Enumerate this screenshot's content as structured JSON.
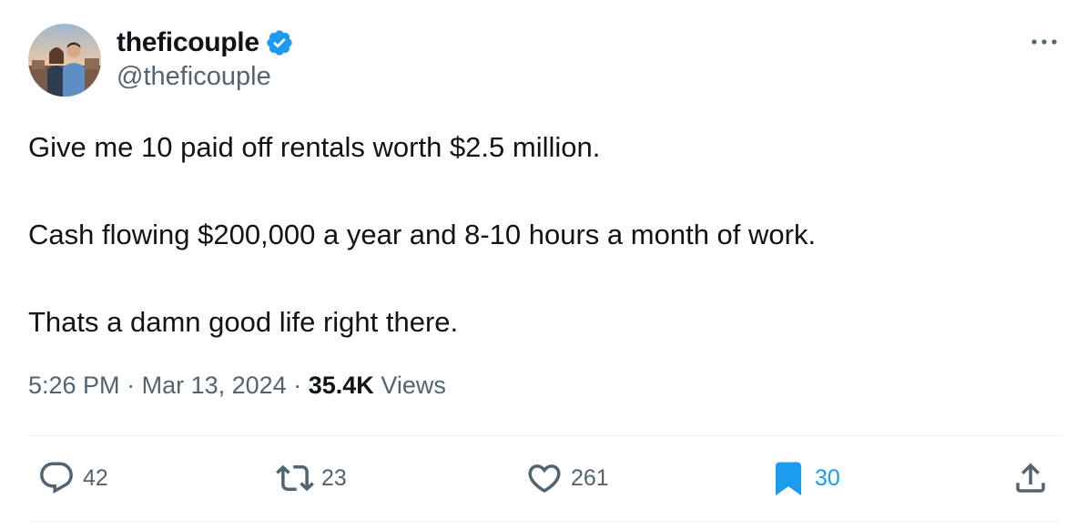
{
  "author": {
    "display_name": "theficouple",
    "handle": "@theficouple",
    "verified": true,
    "avatar_alt": "avatar-photo"
  },
  "tweet": {
    "paragraphs": [
      "Give me 10 paid off rentals worth $2.5 million.",
      "Cash flowing $200,000 a year and 8-10 hours a month of work.",
      "Thats a damn good life right there."
    ],
    "time": "5:26 PM",
    "separator": "·",
    "date": "Mar 13, 2024",
    "views_count": "35.4K",
    "views_label": "Views"
  },
  "actions": {
    "reply_count": "42",
    "retweet_count": "23",
    "like_count": "261",
    "bookmark_count": "30"
  },
  "icons": {
    "reply": "reply-icon",
    "retweet": "retweet-icon",
    "like": "heart-icon",
    "bookmark": "bookmark-icon",
    "share": "share-icon",
    "more": "more-icon",
    "verified": "verified-badge-icon"
  },
  "colors": {
    "text_primary": "#0f1419",
    "text_secondary": "#536471",
    "accent": "#1d9bf0",
    "divider": "#eff3f4"
  }
}
